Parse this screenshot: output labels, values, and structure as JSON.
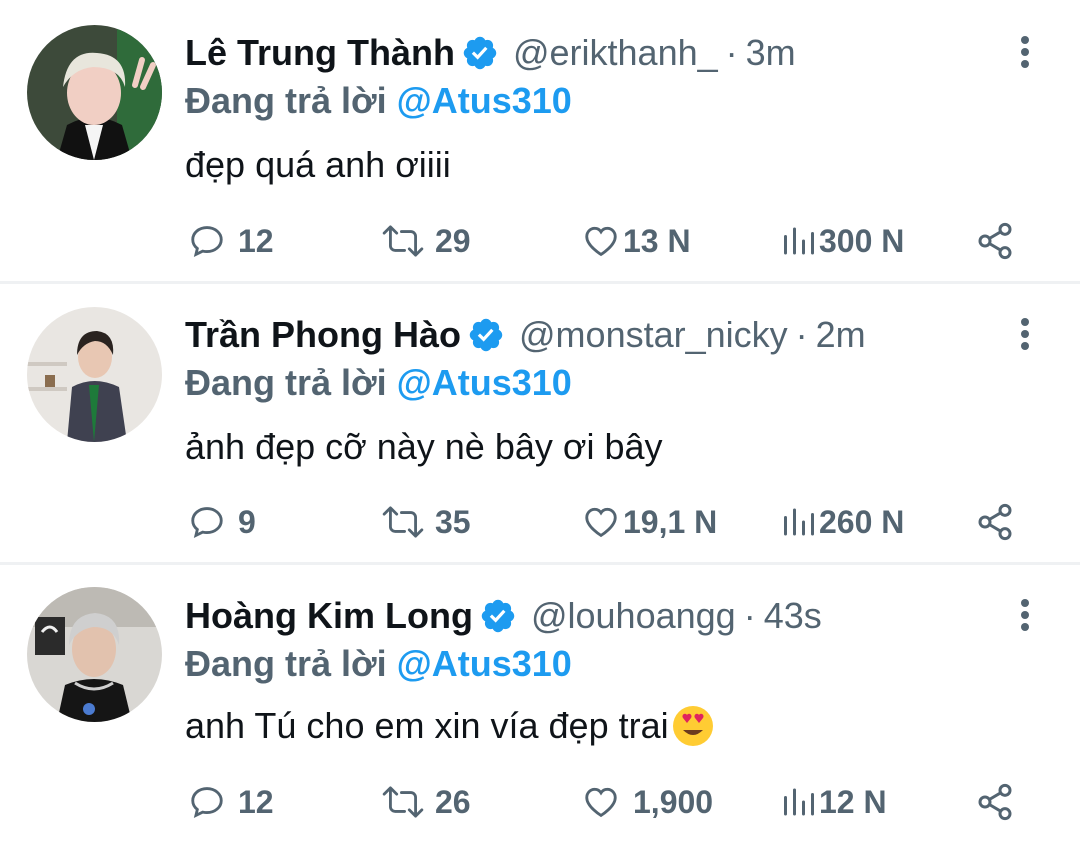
{
  "reply_prefix": "Đang trả lời",
  "tweets": [
    {
      "name": "Lê Trung Thành",
      "handle": "@erikthanh_",
      "separator": "·",
      "time": "3m",
      "reply_to": "@Atus310",
      "text": "đẹp quá anh ơiiii",
      "replies": "12",
      "retweets": "29",
      "likes": "13 N",
      "views": "300 N"
    },
    {
      "name": "Trần Phong Hào",
      "handle": "@monstar_nicky",
      "separator": "·",
      "time": "2m",
      "reply_to": "@Atus310",
      "text": "ảnh đẹp cỡ này nè bây ơi bây",
      "replies": "9",
      "retweets": "35",
      "likes": "19,1 N",
      "views": "260 N"
    },
    {
      "name": "Hoàng Kim Long",
      "handle": "@louhoangg",
      "separator": "·",
      "time": "43s",
      "reply_to": "@Atus310",
      "text": "anh Tú cho em xin vía đẹp trai",
      "replies": "12",
      "retweets": "26",
      "likes": "1,900",
      "views": "12 N"
    }
  ],
  "icons": {
    "verified": "verified-badge-icon",
    "reply": "reply-bubble-icon",
    "retweet": "retweet-arrows-icon",
    "like": "heart-icon",
    "views": "bar-chart-icon",
    "share": "share-icon",
    "more": "more-vertical-icon",
    "emoji": "heart-eyes-emoji"
  },
  "colors": {
    "accent": "#1d9bf0",
    "secondary_text": "#536471",
    "primary_text": "#0f1419",
    "divider": "#eff1f3"
  }
}
